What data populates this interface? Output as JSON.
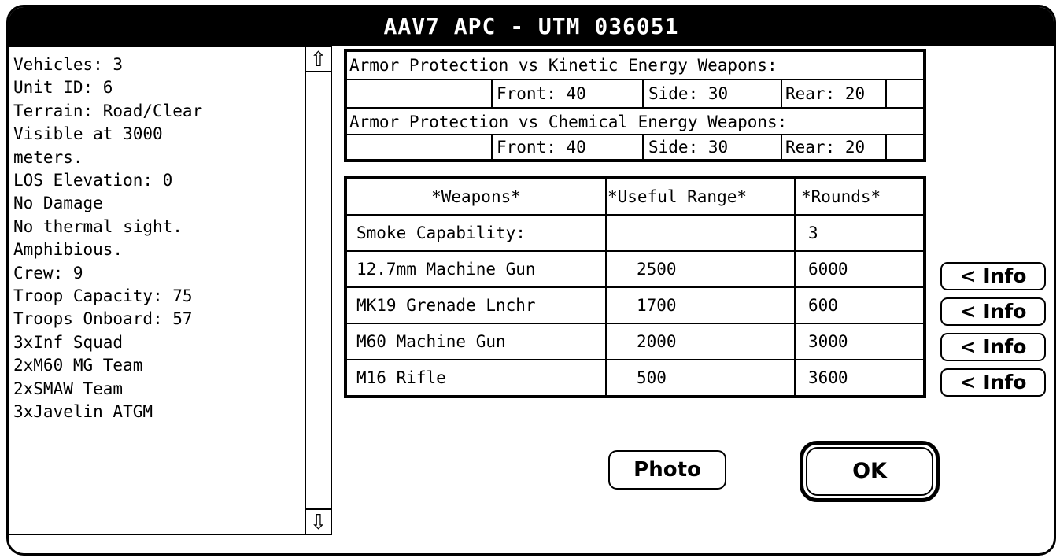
{
  "window": {
    "title": "AAV7 APC - UTM 036051"
  },
  "unit_info": {
    "lines": [
      "Vehicles: 3",
      "Unit ID: 6",
      "Terrain: Road/Clear",
      "Visible at 3000",
      "meters.",
      "LOS Elevation: 0",
      "No Damage",
      "No thermal sight.",
      "Amphibious.",
      "Crew: 9",
      "Troop Capacity: 75",
      "Troops Onboard: 57",
      "3xInf Squad",
      "2xM60 MG Team",
      "2xSMAW Team",
      "3xJavelin ATGM"
    ],
    "scroll_up_glyph": "⇧",
    "scroll_down_glyph": "⇩"
  },
  "armor": {
    "kinetic_header": "Armor Protection vs Kinetic Energy Weapons:",
    "kinetic": {
      "front": "Front: 40",
      "side": "Side: 30",
      "rear": "Rear: 20"
    },
    "chemical_header": "Armor Protection vs Chemical Energy Weapons:",
    "chemical": {
      "front": "Front: 40",
      "side": "Side: 30",
      "rear": "Rear: 20"
    }
  },
  "weapons": {
    "headers": {
      "weapon": "*Weapons*",
      "range": "*Useful Range*",
      "rounds": "*Rounds*"
    },
    "rows": [
      {
        "name": "Smoke Capability:",
        "range": "",
        "rounds": "3",
        "has_info": false
      },
      {
        "name": "12.7mm Machine Gun",
        "range": "2500",
        "rounds": "6000",
        "has_info": true
      },
      {
        "name": "MK19 Grenade Lnchr",
        "range": "1700",
        "rounds": "600",
        "has_info": true
      },
      {
        "name": "M60 Machine Gun",
        "range": "2000",
        "rounds": "3000",
        "has_info": true
      },
      {
        "name": "M16 Rifle",
        "range": "500",
        "rounds": "3600",
        "has_info": true
      }
    ],
    "info_button_label": "< Info"
  },
  "buttons": {
    "photo": "Photo",
    "ok": "OK"
  }
}
